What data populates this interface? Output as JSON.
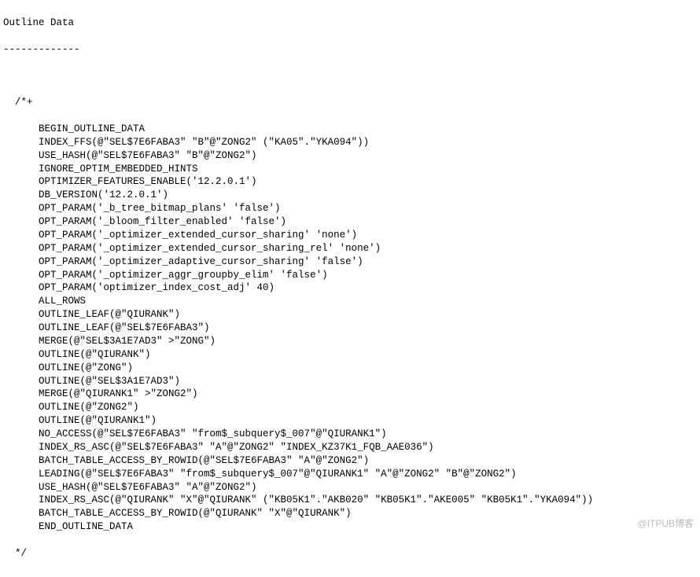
{
  "header": {
    "title": "Outline Data",
    "divider": "-------------"
  },
  "block": {
    "open": "  /*+",
    "close": "  */"
  },
  "indent": "      ",
  "hints": [
    "BEGIN_OUTLINE_DATA",
    "INDEX_FFS(@\"SEL$7E6FABA3\" \"B\"@\"ZONG2\" (\"KA05\".\"YKA094\"))",
    "USE_HASH(@\"SEL$7E6FABA3\" \"B\"@\"ZONG2\")",
    "IGNORE_OPTIM_EMBEDDED_HINTS",
    "OPTIMIZER_FEATURES_ENABLE('12.2.0.1')",
    "DB_VERSION('12.2.0.1')",
    "OPT_PARAM('_b_tree_bitmap_plans' 'false')",
    "OPT_PARAM('_bloom_filter_enabled' 'false')",
    "OPT_PARAM('_optimizer_extended_cursor_sharing' 'none')",
    "OPT_PARAM('_optimizer_extended_cursor_sharing_rel' 'none')",
    "OPT_PARAM('_optimizer_adaptive_cursor_sharing' 'false')",
    "OPT_PARAM('_optimizer_aggr_groupby_elim' 'false')",
    "OPT_PARAM('optimizer_index_cost_adj' 40)",
    "ALL_ROWS",
    "OUTLINE_LEAF(@\"QIURANK\")",
    "OUTLINE_LEAF(@\"SEL$7E6FABA3\")",
    "MERGE(@\"SEL$3A1E7AD3\" >\"ZONG\")",
    "OUTLINE(@\"QIURANK\")",
    "OUTLINE(@\"ZONG\")",
    "OUTLINE(@\"SEL$3A1E7AD3\")",
    "MERGE(@\"QIURANK1\" >\"ZONG2\")",
    "OUTLINE(@\"ZONG2\")",
    "OUTLINE(@\"QIURANK1\")",
    "NO_ACCESS(@\"SEL$7E6FABA3\" \"from$_subquery$_007\"@\"QIURANK1\")",
    "INDEX_RS_ASC(@\"SEL$7E6FABA3\" \"A\"@\"ZONG2\" \"INDEX_KZ37K1_FQB_AAE036\")",
    "BATCH_TABLE_ACCESS_BY_ROWID(@\"SEL$7E6FABA3\" \"A\"@\"ZONG2\")",
    "LEADING(@\"SEL$7E6FABA3\" \"from$_subquery$_007\"@\"QIURANK1\" \"A\"@\"ZONG2\" \"B\"@\"ZONG2\")",
    "USE_HASH(@\"SEL$7E6FABA3\" \"A\"@\"ZONG2\")",
    "INDEX_RS_ASC(@\"QIURANK\" \"X\"@\"QIURANK\" (\"KB05K1\".\"AKB020\" \"KB05K1\".\"AKE005\" \"KB05K1\".\"YKA094\"))",
    "BATCH_TABLE_ACCESS_BY_ROWID(@\"QIURANK\" \"X\"@\"QIURANK\")",
    "END_OUTLINE_DATA"
  ],
  "watermark": "@ITPUB博客"
}
